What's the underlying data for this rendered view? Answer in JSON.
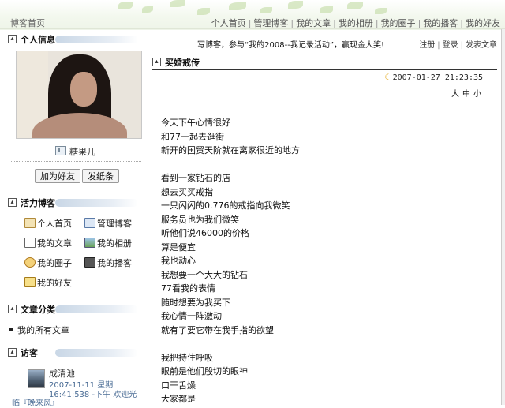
{
  "header": {
    "home_link": "博客首页",
    "nav": [
      "个人首页",
      "管理博客",
      "我的文章",
      "我的相册",
      "我的圈子",
      "我的播客",
      "我的好友"
    ]
  },
  "sidebar": {
    "profile": {
      "title": "个人信息",
      "name": "糖果儿",
      "buttons": [
        "加为好友",
        "发纸条"
      ]
    },
    "activity": {
      "title": "活力博客",
      "links": [
        {
          "label": "个人首页",
          "icon": "home-icon"
        },
        {
          "label": "管理博客",
          "icon": "manage-icon"
        },
        {
          "label": "我的文章",
          "icon": "article-icon"
        },
        {
          "label": "我的相册",
          "icon": "album-icon"
        },
        {
          "label": "我的圈子",
          "icon": "circle-icon"
        },
        {
          "label": "我的播客",
          "icon": "podcast-icon"
        },
        {
          "label": "我的好友",
          "icon": "friends-icon"
        }
      ]
    },
    "categories": {
      "title": "文章分类",
      "items": [
        "我的所有文章"
      ]
    },
    "visitors": {
      "title": "访客",
      "name": "成清池",
      "line1": "2007-11-11 星期",
      "line2": "16:41:538 -下午 欢迎光",
      "line3": "临『晚来风』"
    }
  },
  "topbar": {
    "promo": "写博客，参与“我的2008--我记录活动”，赢现金大奖!",
    "account_links": [
      "注册",
      "登录",
      "发表文章"
    ]
  },
  "post": {
    "title": "买婚戒传",
    "date": "2007-01-27 21:23:35",
    "size_controls": [
      "大",
      "中",
      "小"
    ],
    "lines": [
      "今天下午心情很好",
      "和77一起去逛街",
      "新开的国贸天阶就在离家很近的地方",
      "",
      "看到一家钻石的店",
      "想去买买戒指",
      "一只闪闪的0.776的戒指向我微笑",
      "服务员也为我们微笑",
      "听他们说46000的价格",
      "算是便宜",
      "我也动心",
      "我想要一个大大的钻石",
      "77看我的表情",
      "随时想要为我买下",
      "我心情一阵激动",
      "就有了要它带在我手指的欲望",
      "",
      "我把持住呼吸",
      "眼前是他们殷切的眼神",
      "口干舌燥",
      "大家都是"
    ]
  }
}
